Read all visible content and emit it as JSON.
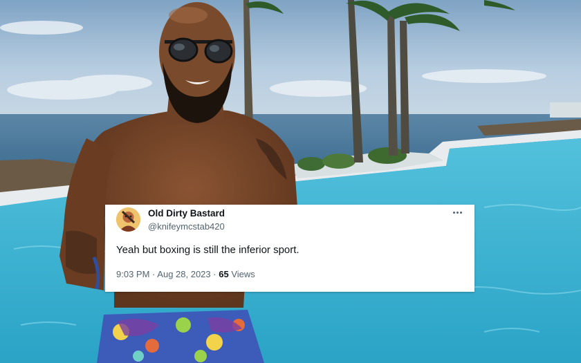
{
  "tweet": {
    "display_name": "Old Dirty Bastard",
    "handle": "@knifeymcstab420",
    "text": "Yeah but boxing is still the inferior sport.",
    "time": "9:03 PM",
    "separator": "·",
    "date": "Aug 28, 2023",
    "views_count": "65",
    "views_label": "Views",
    "more_icon": "more-horizontal-icon"
  },
  "background": {
    "sky_color": "#b9cfe2",
    "ocean_color": "#4f7fa3",
    "pool_color": "#3fb6d3",
    "skin_color": "#7a4a2c"
  }
}
